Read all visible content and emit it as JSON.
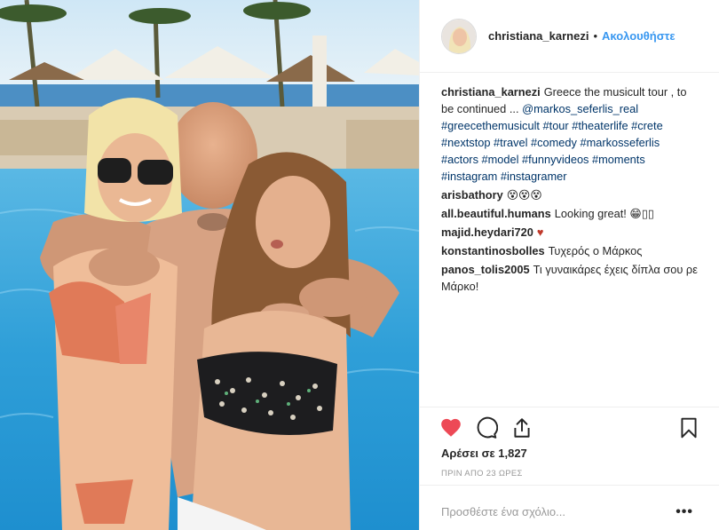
{
  "post": {
    "author": "christiana_karnezi",
    "separator": "•",
    "follow_label": "Ακολουθήστε",
    "photo_alt": "Beach pool photo"
  },
  "comments": [
    {
      "user": "christiana_karnezi",
      "text": "Greece the musicult tour , to be continued ... ",
      "mention": "@markos_seferlis_real",
      "hashtags": "#greecethemusicult #tour #theaterlife #crete #nextstop #travel #comedy #markosseferlis #actors #model #funnyvideos #moments #instagram #instagramer"
    },
    {
      "user": "arisbathory",
      "text": "😵😵😵"
    },
    {
      "user": "all.beautiful.humans",
      "text": "Looking great! 😁▯▯"
    },
    {
      "user": "majid.heydari720",
      "text": "♥"
    },
    {
      "user": "konstantinosbolles",
      "text": "Τυχερός ο Μάρκος"
    },
    {
      "user": "panos_tolis2005",
      "text": "Τι γυναικάρες έχεις δίπλα σου ρε Μάρκο!"
    }
  ],
  "actions": {
    "like_icon": "heart-icon",
    "comment_icon": "comment-icon",
    "share_icon": "share-icon",
    "save_icon": "bookmark-icon",
    "like_color": "#ed4956"
  },
  "likes_label": "Αρέσει σε 1,827",
  "timestamp": "ΠΡΙΝ ΑΠΟ 23 ΩΡΕΣ",
  "add_comment": {
    "placeholder": "Προσθέστε ένα σχόλιο...",
    "more": "•••"
  }
}
